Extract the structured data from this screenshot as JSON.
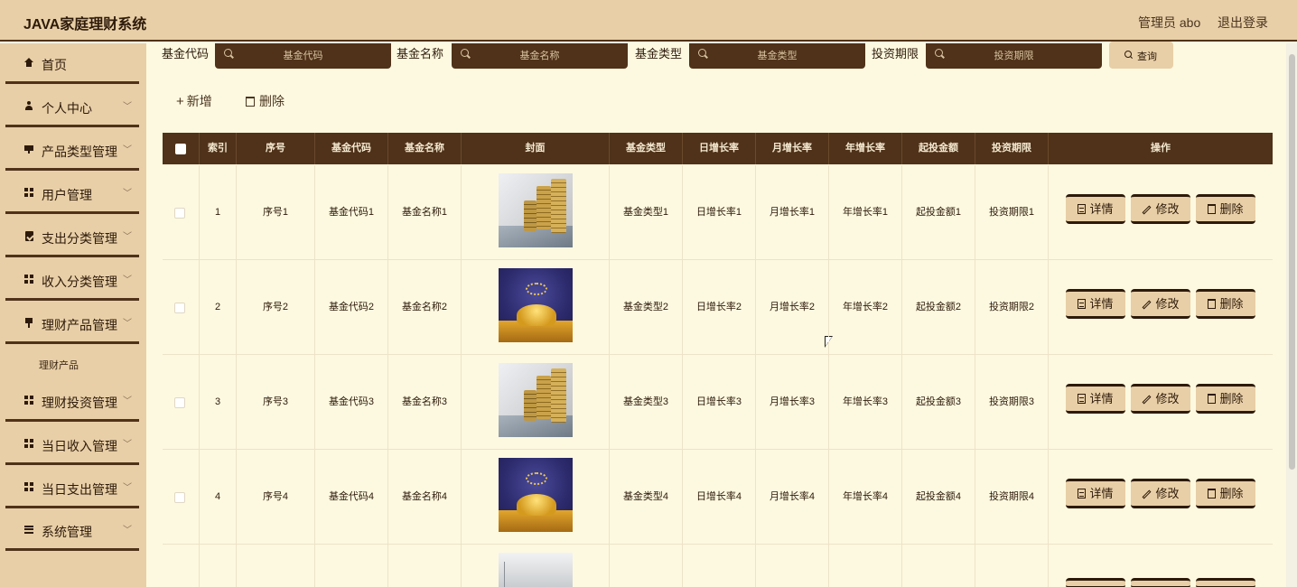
{
  "header": {
    "title": "JAVA家庭理财系统",
    "user": "管理员 abo",
    "logout": "退出登录"
  },
  "sidebar": {
    "items": [
      {
        "label": "首页",
        "icon": "home-icon"
      },
      {
        "label": "个人中心",
        "icon": "user-icon"
      },
      {
        "label": "产品类型管理",
        "icon": "monitor-icon"
      },
      {
        "label": "用户管理",
        "icon": "grid-icon"
      },
      {
        "label": "支出分类管理",
        "icon": "clipboard-icon"
      },
      {
        "label": "收入分类管理",
        "icon": "grid-icon"
      },
      {
        "label": "理财产品管理",
        "icon": "pin-icon"
      },
      {
        "label": "理财投资管理",
        "icon": "grid-icon"
      },
      {
        "label": "当日收入管理",
        "icon": "grid-icon"
      },
      {
        "label": "当日支出管理",
        "icon": "grid-icon"
      },
      {
        "label": "系统管理",
        "icon": "list-icon"
      }
    ],
    "sub_item": "理财产品"
  },
  "search": {
    "fields": [
      {
        "label": "基金代码",
        "placeholder": "基金代码"
      },
      {
        "label": "基金名称",
        "placeholder": "基金名称"
      },
      {
        "label": "基金类型",
        "placeholder": "基金类型"
      },
      {
        "label": "投资期限",
        "placeholder": "投资期限"
      }
    ],
    "query": "查询"
  },
  "actions": {
    "add": "新增",
    "delete": "删除"
  },
  "table": {
    "columns": [
      "索引",
      "序号",
      "基金代码",
      "基金名称",
      "封面",
      "基金类型",
      "日增长率",
      "月增长率",
      "年增长率",
      "起投金额",
      "投资期限",
      "操作"
    ],
    "rows": [
      {
        "index": "1",
        "seq": "序号1",
        "code": "基金代码1",
        "name": "基金名称1",
        "cover": "coins",
        "type": "基金类型1",
        "daily": "日增长率1",
        "monthly": "月增长率1",
        "yearly": "年增长率1",
        "min": "起投金额1",
        "term": "投资期限1"
      },
      {
        "index": "2",
        "seq": "序号2",
        "code": "基金代码2",
        "name": "基金名称2",
        "cover": "bowl",
        "type": "基金类型2",
        "daily": "日增长率2",
        "monthly": "月增长率2",
        "yearly": "年增长率2",
        "min": "起投金额2",
        "term": "投资期限2"
      },
      {
        "index": "3",
        "seq": "序号3",
        "code": "基金代码3",
        "name": "基金名称3",
        "cover": "coins",
        "type": "基金类型3",
        "daily": "日增长率3",
        "monthly": "月增长率3",
        "yearly": "年增长率3",
        "min": "起投金额3",
        "term": "投资期限3"
      },
      {
        "index": "4",
        "seq": "序号4",
        "code": "基金代码4",
        "name": "基金名称4",
        "cover": "bowl",
        "type": "基金类型4",
        "daily": "日增长率4",
        "monthly": "月增长率4",
        "yearly": "年增长率4",
        "min": "起投金额4",
        "term": "投资期限4"
      }
    ],
    "ops": {
      "detail": "详情",
      "edit": "修改",
      "delete": "删除"
    }
  },
  "colors": {
    "header_bg": "#e8cfa7",
    "dark_brown": "#4f3219",
    "page_bg": "#fdf9e0"
  }
}
